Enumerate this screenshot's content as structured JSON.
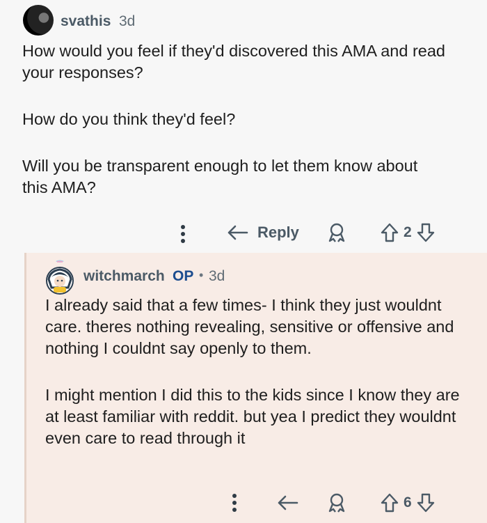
{
  "comment": {
    "username": "svathis",
    "time": "3d",
    "paragraphs": [
      "How would you feel if they'd discovered this AMA and read your responses?",
      "How do you think they'd feel?",
      "Will you be transparent enough to let them know about this AMA?"
    ],
    "reply_label": "Reply",
    "score": "2"
  },
  "reply": {
    "username": "witchmarch",
    "op_badge": "OP",
    "separator": "•",
    "time": "3d",
    "paragraphs": [
      "I already said that a few times- I think they just wouldnt care. theres nothing revealing, sensitive or offensive and nothing I couldnt say openly to them.",
      "I might mention I did this to the kids since I know they are at least familiar with reddit. but yea I predict they wouldnt even care to read through it"
    ],
    "score": "6"
  },
  "icons": {
    "more": "more-dots-icon",
    "reply": "reply-arrow-icon",
    "award": "award-icon",
    "upvote": "upvote-icon",
    "downvote": "downvote-icon"
  },
  "colors": {
    "reply_background": "#f8ece6",
    "op_badge": "#1d4d8f",
    "text": "#1e1e1e",
    "meta": "#4b5a66"
  }
}
